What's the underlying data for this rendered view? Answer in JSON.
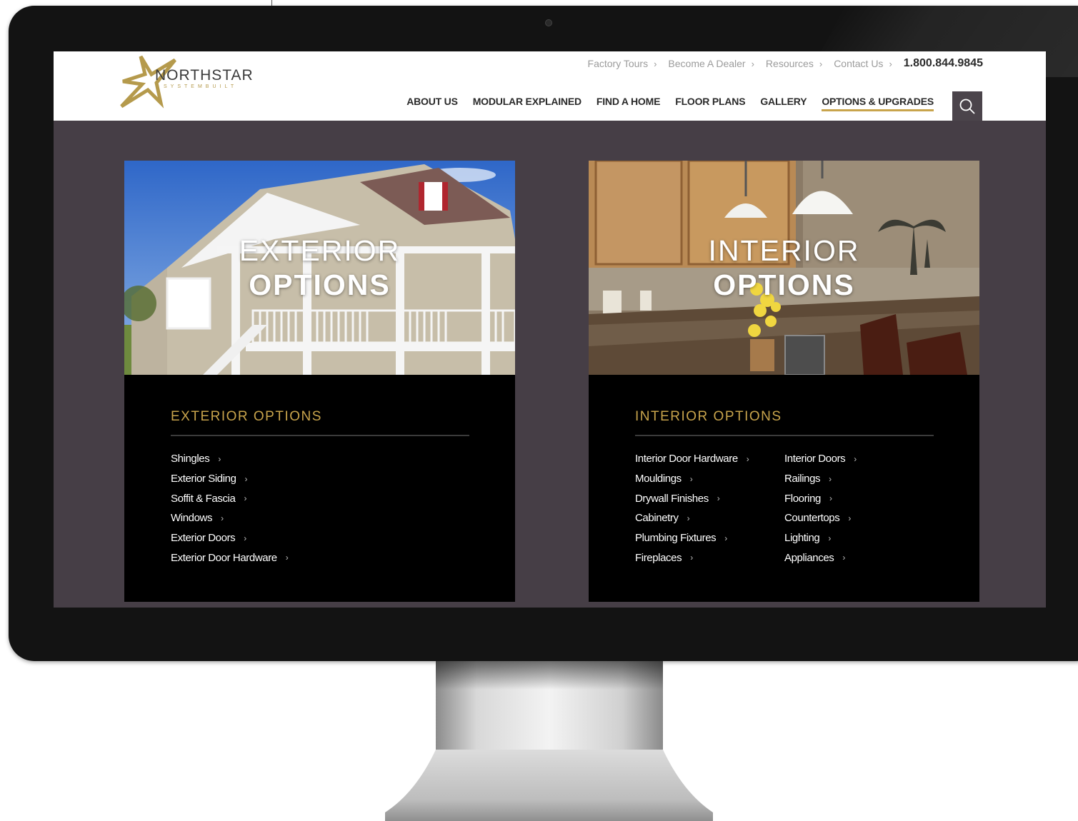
{
  "brand": {
    "name": "NORTHSTAR",
    "tagline": "SYSTEMBUILT",
    "accent_color": "#c8a44c"
  },
  "util_nav": {
    "items": [
      {
        "label": "Factory Tours",
        "icon": "chevron-right-icon"
      },
      {
        "label": "Become A Dealer",
        "icon": "chevron-right-icon"
      },
      {
        "label": "Resources",
        "icon": "chevron-right-icon"
      },
      {
        "label": "Contact Us",
        "icon": "chevron-right-icon"
      }
    ],
    "phone": "1.800.844.9845"
  },
  "main_nav": {
    "items": [
      {
        "label": "ABOUT US"
      },
      {
        "label": "MODULAR EXPLAINED"
      },
      {
        "label": "FIND A HOME"
      },
      {
        "label": "FLOOR PLANS"
      },
      {
        "label": "GALLERY"
      },
      {
        "label": "OPTIONS & UPGRADES",
        "active": true
      }
    ],
    "search_icon": "search-icon"
  },
  "exterior": {
    "hero_line1": "EXTERIOR",
    "hero_line2": "OPTIONS",
    "section_title": "EXTERIOR OPTIONS",
    "links": [
      "Shingles",
      "Exterior Siding",
      "Soffit & Fascia",
      "Windows",
      "Exterior Doors",
      "Exterior Door Hardware"
    ]
  },
  "interior": {
    "hero_line1": "INTERIOR",
    "hero_line2": "OPTIONS",
    "section_title": "INTERIOR OPTIONS",
    "links_col1": [
      "Interior Door Hardware",
      "Mouldings",
      "Drywall Finishes",
      "Cabinetry",
      "Plumbing Fixtures",
      "Fireplaces"
    ],
    "links_col2": [
      "Interior Doors",
      "Railings",
      "Flooring",
      "Countertops",
      "Lighting",
      "Appliances"
    ]
  }
}
